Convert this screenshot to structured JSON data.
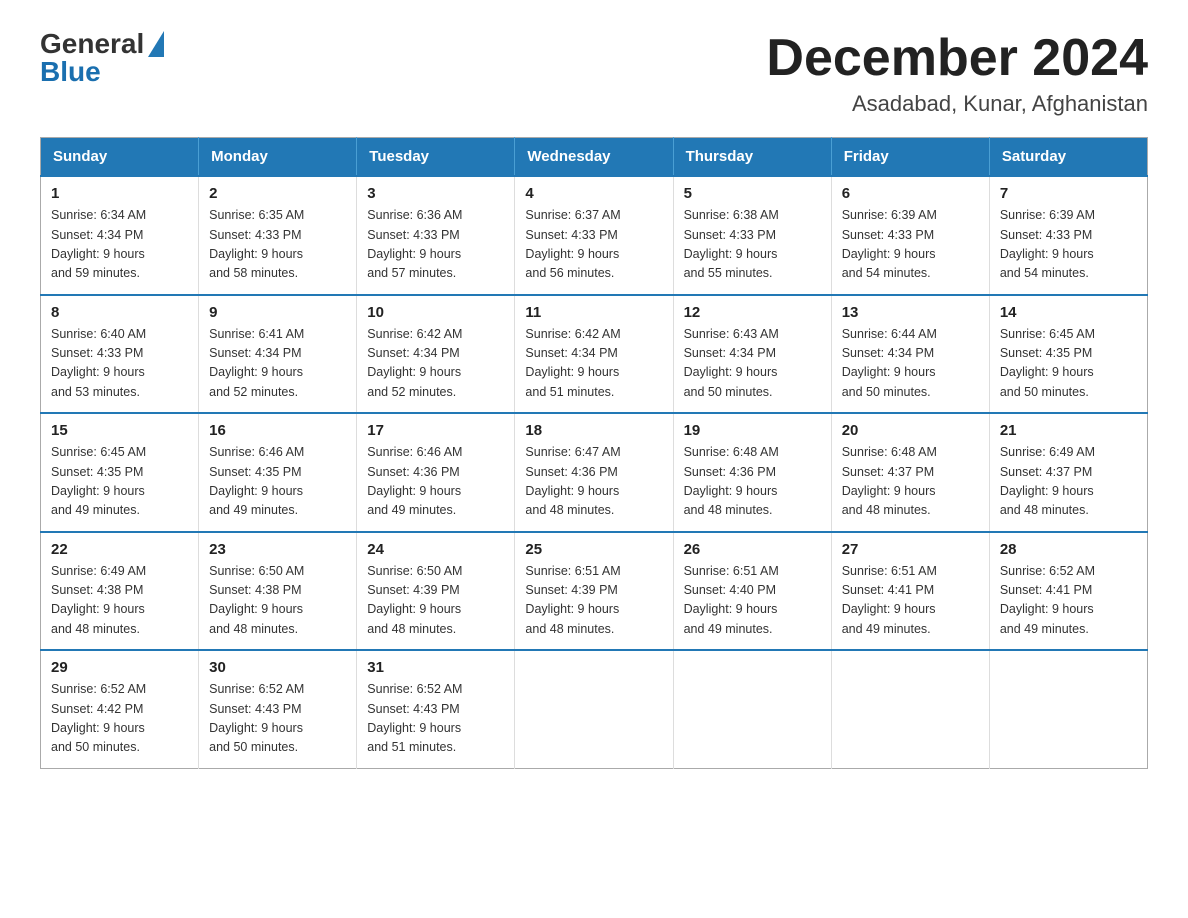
{
  "logo": {
    "general": "General",
    "blue": "Blue"
  },
  "header": {
    "month_year": "December 2024",
    "location": "Asadabad, Kunar, Afghanistan"
  },
  "weekdays": [
    "Sunday",
    "Monday",
    "Tuesday",
    "Wednesday",
    "Thursday",
    "Friday",
    "Saturday"
  ],
  "weeks": [
    [
      {
        "day": "1",
        "sunrise": "6:34 AM",
        "sunset": "4:34 PM",
        "daylight": "9 hours and 59 minutes."
      },
      {
        "day": "2",
        "sunrise": "6:35 AM",
        "sunset": "4:33 PM",
        "daylight": "9 hours and 58 minutes."
      },
      {
        "day": "3",
        "sunrise": "6:36 AM",
        "sunset": "4:33 PM",
        "daylight": "9 hours and 57 minutes."
      },
      {
        "day": "4",
        "sunrise": "6:37 AM",
        "sunset": "4:33 PM",
        "daylight": "9 hours and 56 minutes."
      },
      {
        "day": "5",
        "sunrise": "6:38 AM",
        "sunset": "4:33 PM",
        "daylight": "9 hours and 55 minutes."
      },
      {
        "day": "6",
        "sunrise": "6:39 AM",
        "sunset": "4:33 PM",
        "daylight": "9 hours and 54 minutes."
      },
      {
        "day": "7",
        "sunrise": "6:39 AM",
        "sunset": "4:33 PM",
        "daylight": "9 hours and 54 minutes."
      }
    ],
    [
      {
        "day": "8",
        "sunrise": "6:40 AM",
        "sunset": "4:33 PM",
        "daylight": "9 hours and 53 minutes."
      },
      {
        "day": "9",
        "sunrise": "6:41 AM",
        "sunset": "4:34 PM",
        "daylight": "9 hours and 52 minutes."
      },
      {
        "day": "10",
        "sunrise": "6:42 AM",
        "sunset": "4:34 PM",
        "daylight": "9 hours and 52 minutes."
      },
      {
        "day": "11",
        "sunrise": "6:42 AM",
        "sunset": "4:34 PM",
        "daylight": "9 hours and 51 minutes."
      },
      {
        "day": "12",
        "sunrise": "6:43 AM",
        "sunset": "4:34 PM",
        "daylight": "9 hours and 50 minutes."
      },
      {
        "day": "13",
        "sunrise": "6:44 AM",
        "sunset": "4:34 PM",
        "daylight": "9 hours and 50 minutes."
      },
      {
        "day": "14",
        "sunrise": "6:45 AM",
        "sunset": "4:35 PM",
        "daylight": "9 hours and 50 minutes."
      }
    ],
    [
      {
        "day": "15",
        "sunrise": "6:45 AM",
        "sunset": "4:35 PM",
        "daylight": "9 hours and 49 minutes."
      },
      {
        "day": "16",
        "sunrise": "6:46 AM",
        "sunset": "4:35 PM",
        "daylight": "9 hours and 49 minutes."
      },
      {
        "day": "17",
        "sunrise": "6:46 AM",
        "sunset": "4:36 PM",
        "daylight": "9 hours and 49 minutes."
      },
      {
        "day": "18",
        "sunrise": "6:47 AM",
        "sunset": "4:36 PM",
        "daylight": "9 hours and 48 minutes."
      },
      {
        "day": "19",
        "sunrise": "6:48 AM",
        "sunset": "4:36 PM",
        "daylight": "9 hours and 48 minutes."
      },
      {
        "day": "20",
        "sunrise": "6:48 AM",
        "sunset": "4:37 PM",
        "daylight": "9 hours and 48 minutes."
      },
      {
        "day": "21",
        "sunrise": "6:49 AM",
        "sunset": "4:37 PM",
        "daylight": "9 hours and 48 minutes."
      }
    ],
    [
      {
        "day": "22",
        "sunrise": "6:49 AM",
        "sunset": "4:38 PM",
        "daylight": "9 hours and 48 minutes."
      },
      {
        "day": "23",
        "sunrise": "6:50 AM",
        "sunset": "4:38 PM",
        "daylight": "9 hours and 48 minutes."
      },
      {
        "day": "24",
        "sunrise": "6:50 AM",
        "sunset": "4:39 PM",
        "daylight": "9 hours and 48 minutes."
      },
      {
        "day": "25",
        "sunrise": "6:51 AM",
        "sunset": "4:39 PM",
        "daylight": "9 hours and 48 minutes."
      },
      {
        "day": "26",
        "sunrise": "6:51 AM",
        "sunset": "4:40 PM",
        "daylight": "9 hours and 49 minutes."
      },
      {
        "day": "27",
        "sunrise": "6:51 AM",
        "sunset": "4:41 PM",
        "daylight": "9 hours and 49 minutes."
      },
      {
        "day": "28",
        "sunrise": "6:52 AM",
        "sunset": "4:41 PM",
        "daylight": "9 hours and 49 minutes."
      }
    ],
    [
      {
        "day": "29",
        "sunrise": "6:52 AM",
        "sunset": "4:42 PM",
        "daylight": "9 hours and 50 minutes."
      },
      {
        "day": "30",
        "sunrise": "6:52 AM",
        "sunset": "4:43 PM",
        "daylight": "9 hours and 50 minutes."
      },
      {
        "day": "31",
        "sunrise": "6:52 AM",
        "sunset": "4:43 PM",
        "daylight": "9 hours and 51 minutes."
      },
      null,
      null,
      null,
      null
    ]
  ],
  "labels": {
    "sunrise": "Sunrise: ",
    "sunset": "Sunset: ",
    "daylight": "Daylight: "
  }
}
